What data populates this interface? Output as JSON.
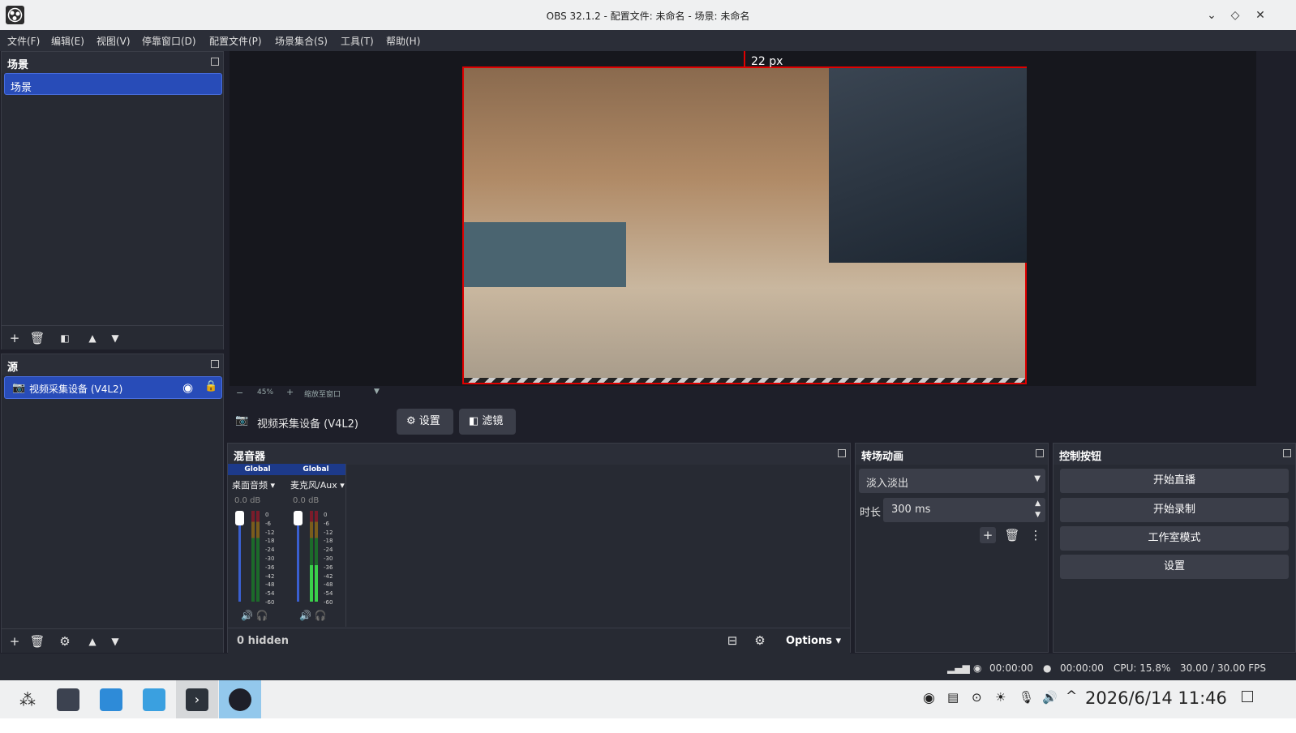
{
  "window": {
    "title": "OBS 32.1.2 - 配置文件: 未命名 - 场景: 未命名"
  },
  "menu": [
    "文件(F)",
    "编辑(E)",
    "视图(V)",
    "停靠窗口(D)",
    "配置文件(P)",
    "场景集合(S)",
    "工具(T)",
    "帮助(H)"
  ],
  "scenes": {
    "title": "场景",
    "items": [
      "场景"
    ]
  },
  "sources": {
    "title": "源",
    "items": [
      "视频采集设备 (V4L2)"
    ]
  },
  "preview": {
    "distance_label": "22 px",
    "zoom": "45%",
    "zoom_mode": "缩放至窗口"
  },
  "source_context": {
    "name": "视频采集设备 (V4L2)",
    "settings_label": "设置",
    "filters_label": "滤镜"
  },
  "mixer": {
    "title": "混音器",
    "channels": [
      {
        "badge": "Global",
        "name": "桌面音频",
        "db": "0.0 dB"
      },
      {
        "badge": "Global",
        "name": "麦克风/Aux",
        "db": "0.0 dB"
      }
    ],
    "ticks": [
      "0",
      "-6",
      "-12",
      "-18",
      "-24",
      "-30",
      "-36",
      "-42",
      "-48",
      "-54",
      "-60"
    ],
    "hidden_label": "0 hidden",
    "options_label": "Options"
  },
  "transitions": {
    "title": "转场动画",
    "selected": "淡入淡出",
    "duration_label": "时长",
    "duration_value": "300 ms"
  },
  "controls": {
    "title": "控制按钮",
    "buttons": [
      "开始直播",
      "开始录制",
      "工作室模式",
      "设置"
    ]
  },
  "status": {
    "stream_time": "00:00:00",
    "record_time": "00:00:00",
    "cpu": "CPU: 15.8%",
    "fps": "30.00 / 30.00 FPS"
  },
  "taskbar": {
    "clock": "2026/6/14 11:46"
  },
  "colors": {
    "accent": "#284cb8",
    "selection_border": "#e00000",
    "panel": "#272a33",
    "background": "#1e1f29"
  }
}
